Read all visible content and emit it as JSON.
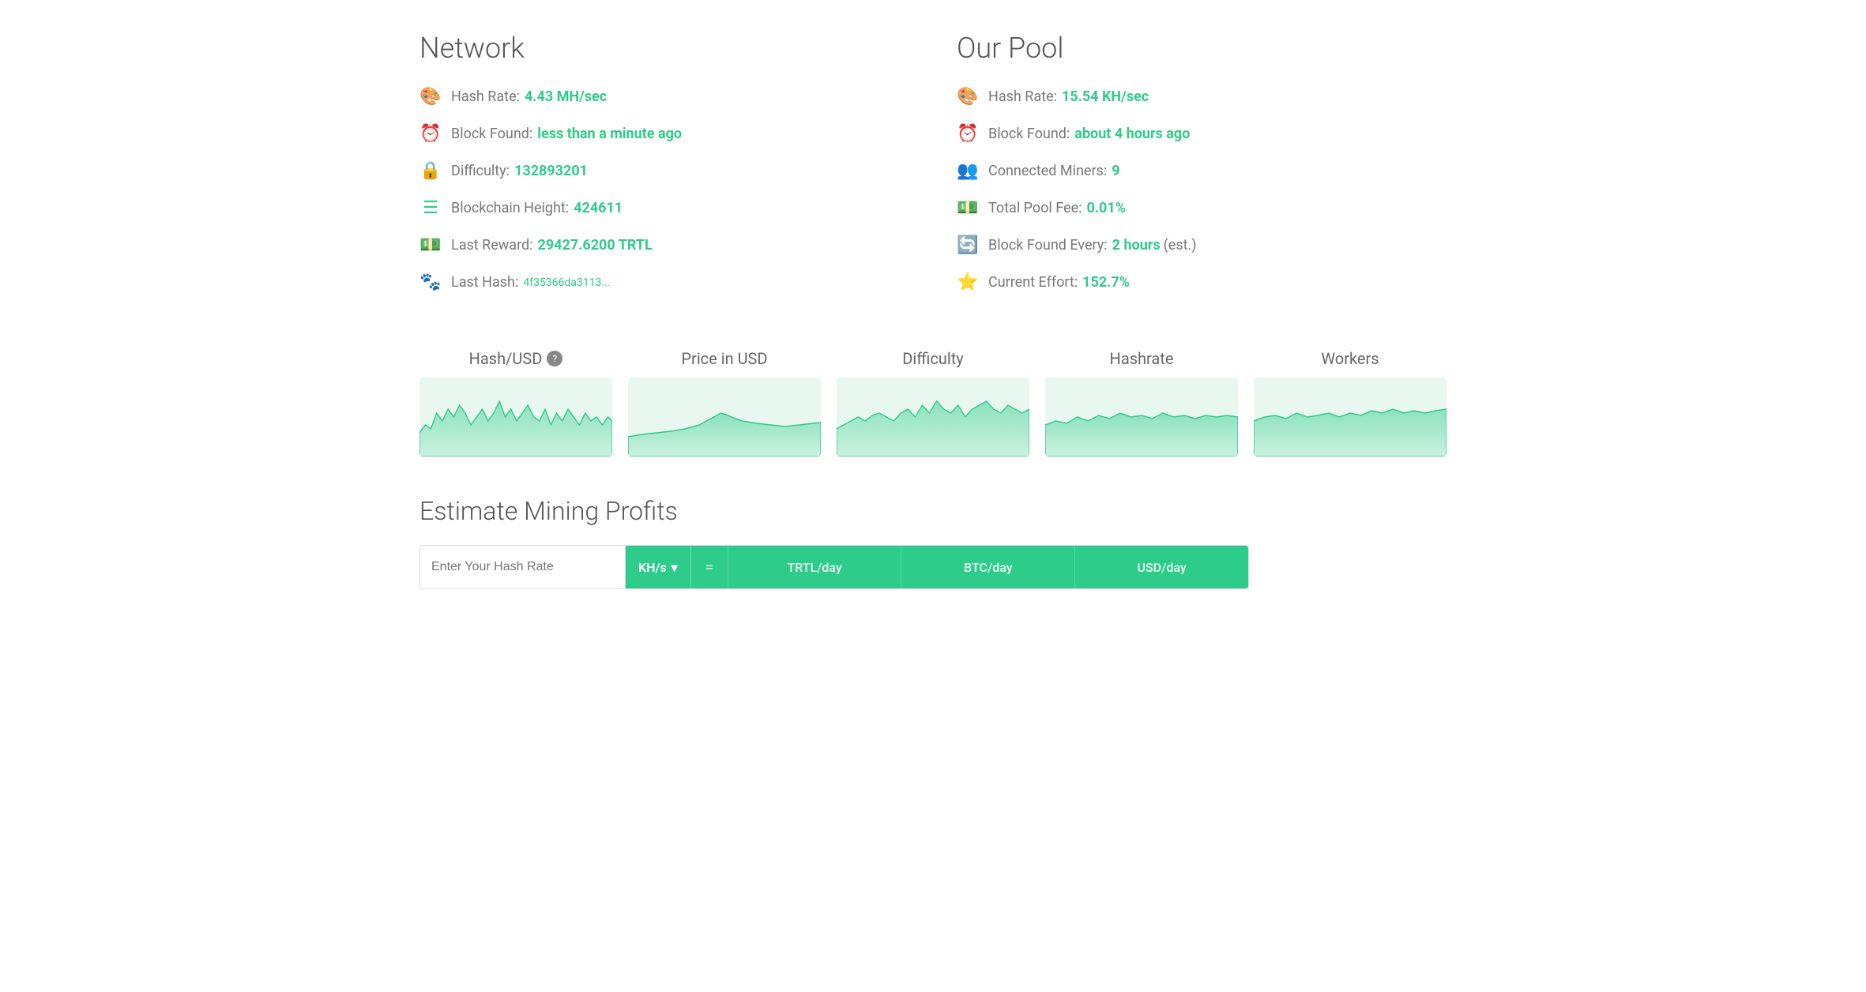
{
  "network": {
    "title": "Network",
    "stats": [
      {
        "id": "hash-rate",
        "icon": "🎨",
        "label": "Hash Rate:",
        "value": "4.43 MH/sec"
      },
      {
        "id": "block-found",
        "icon": "⏰",
        "label": "Block Found:",
        "value": "less than a minute ago"
      },
      {
        "id": "difficulty",
        "icon": "🔒",
        "label": "Difficulty:",
        "value": "132893201"
      },
      {
        "id": "blockchain-height",
        "icon": "☰",
        "label": "Blockchain Height:",
        "value": "424611"
      },
      {
        "id": "last-reward",
        "icon": "💵",
        "label": "Last Reward:",
        "value": "29427.6200 TRTL"
      },
      {
        "id": "last-hash",
        "icon": "🐾",
        "label": "Last Hash:",
        "value": "4f35366da3113..."
      }
    ]
  },
  "pool": {
    "title": "Our Pool",
    "stats": [
      {
        "id": "pool-hash-rate",
        "icon": "🎨",
        "label": "Hash Rate:",
        "value": "15.54 KH/sec"
      },
      {
        "id": "pool-block-found",
        "icon": "⏰",
        "label": "Block Found:",
        "value": "about 4 hours ago"
      },
      {
        "id": "connected-miners",
        "icon": "👥",
        "label": "Connected Miners:",
        "value": "9"
      },
      {
        "id": "total-pool-fee",
        "icon": "💵",
        "label": "Total Pool Fee:",
        "value": "0.01%"
      },
      {
        "id": "block-found-every",
        "icon": "🔄",
        "label": "Block Found Every:",
        "value": "2 hours",
        "suffix": "(est.)"
      },
      {
        "id": "current-effort",
        "icon": "⭐",
        "label": "Current Effort:",
        "value": "152.7%"
      }
    ]
  },
  "charts": [
    {
      "id": "hash-usd",
      "title": "Hash/USD",
      "has_help": true
    },
    {
      "id": "price-usd",
      "title": "Price in USD",
      "has_help": false
    },
    {
      "id": "difficulty",
      "title": "Difficulty",
      "has_help": false
    },
    {
      "id": "hashrate",
      "title": "Hashrate",
      "has_help": false
    },
    {
      "id": "workers",
      "title": "Workers",
      "has_help": false
    }
  ],
  "estimate": {
    "title": "Estimate Mining Profits",
    "input_placeholder": "Enter Your Hash Rate",
    "unit_label": "KH/s",
    "dropdown_icon": "▼",
    "equals": "=",
    "results": [
      {
        "id": "trtl-day",
        "label": "TRTL/day"
      },
      {
        "id": "btc-day",
        "label": "BTC/day"
      },
      {
        "id": "usd-day",
        "label": "USD/day"
      }
    ]
  },
  "colors": {
    "teal": "#2ecc8a",
    "text_dark": "#555",
    "text_light": "#777",
    "chart_fill": "#c8f0dd",
    "chart_stroke": "#2ecc8a"
  }
}
